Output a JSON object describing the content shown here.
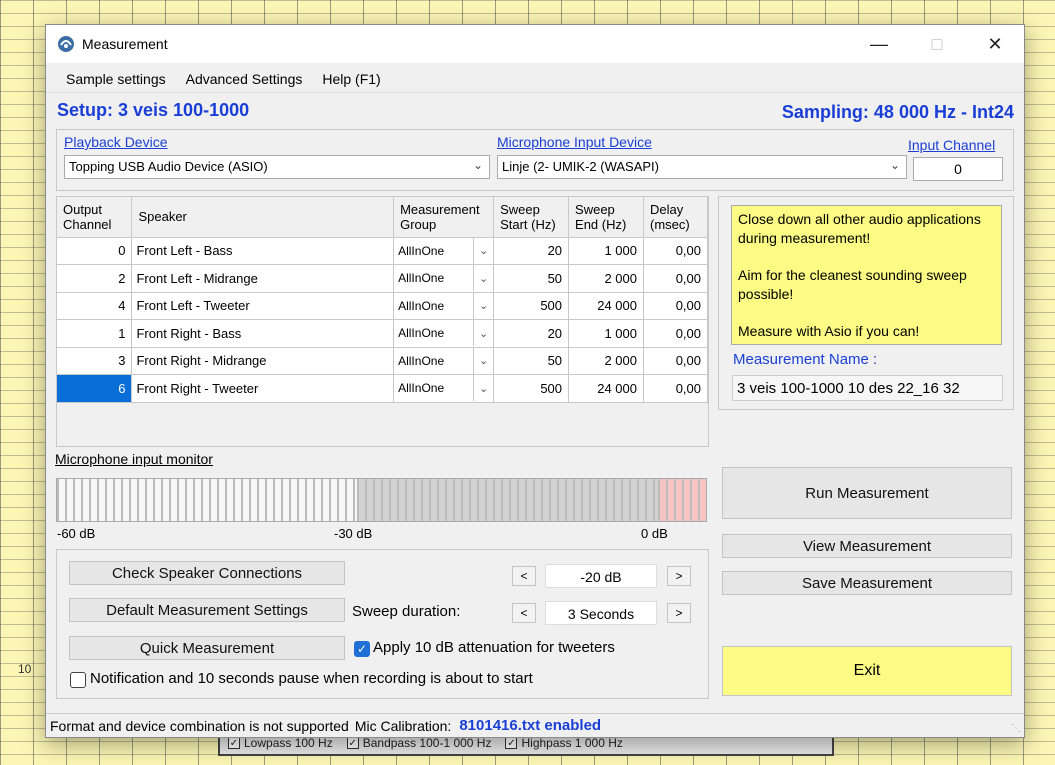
{
  "window": {
    "title": "Measurement"
  },
  "menu": [
    "Sample settings",
    "Advanced Settings",
    "Help (F1)"
  ],
  "setup_title": "Setup: 3 veis 100-1000",
  "sampling_title": "Sampling: 48 000 Hz - Int24",
  "devices": {
    "playback_label": "Playback Device",
    "playback_value": "Topping USB Audio Device (ASIO)",
    "mic_label": "Microphone Input Device",
    "mic_value": "Linje (2- UMIK-2 (WASAPI)",
    "input_channel_label": "Input Channel",
    "input_channel_value": "0"
  },
  "table": {
    "headers": [
      "Output\nChannel",
      "Speaker",
      "Measurement\nGroup",
      "Sweep\nStart (Hz)",
      "Sweep\nEnd (Hz)",
      "Delay\n(msec)"
    ],
    "rows": [
      {
        "channel": "0",
        "speaker": "Front Left - Bass",
        "group": "AllInOne",
        "start": "20",
        "end": "1 000",
        "delay": "0,00"
      },
      {
        "channel": "2",
        "speaker": "Front Left - Midrange",
        "group": "AllInOne",
        "start": "50",
        "end": "2 000",
        "delay": "0,00"
      },
      {
        "channel": "4",
        "speaker": "Front Left - Tweeter",
        "group": "AllInOne",
        "start": "500",
        "end": "24 000",
        "delay": "0,00"
      },
      {
        "channel": "1",
        "speaker": "Front Right - Bass",
        "group": "AllInOne",
        "start": "20",
        "end": "1 000",
        "delay": "0,00"
      },
      {
        "channel": "3",
        "speaker": "Front Right - Midrange",
        "group": "AllInOne",
        "start": "50",
        "end": "2 000",
        "delay": "0,00"
      },
      {
        "channel": "6",
        "speaker": "Front Right - Tweeter",
        "group": "AllInOne",
        "start": "500",
        "end": "24 000",
        "delay": "0,00"
      }
    ],
    "selected_row": 5
  },
  "info": {
    "line1": "Close down all other audio applications during measurement!",
    "line2": "Aim for the cleanest sounding sweep possible!",
    "line3": "Measure with Asio if you can!",
    "meas_name_label": "Measurement Name :",
    "meas_name_value": "3 veis 100-1000 10 des 22_16 32"
  },
  "monitor": {
    "label": "Microphone input monitor",
    "db_min": "-60 dB",
    "db_mid": "-30 dB",
    "db_max": "0 dB"
  },
  "controls": {
    "check_connections": "Check Speaker Connections",
    "default_settings": "Default Measurement Settings",
    "quick_measurement": "Quick Measurement",
    "level_value": "-20 dB",
    "sweep_duration_label": "Sweep duration:",
    "sweep_duration_value": "3 Seconds",
    "prev": "<",
    "next": ">",
    "apply_attenuation": "Apply 10 dB attenuation for tweeters",
    "apply_attenuation_checked": true,
    "notification": "Notification and 10 seconds pause when recording is about to start",
    "notification_checked": false
  },
  "actions": {
    "run": "Run Measurement",
    "view": "View Measurement",
    "save": "Save Measurement",
    "exit": "Exit"
  },
  "status": {
    "message": "Format and device combination is not supported",
    "mic_cal_label": "Mic Calibration:",
    "mic_cal_value": "8101416.txt enabled"
  },
  "background": {
    "tick_label": "10",
    "legend": [
      "Lowpass 100 Hz",
      "Bandpass 100-1 000 Hz",
      "Highpass 1 000 Hz"
    ]
  },
  "colors": {
    "accent_blue": "#1a3fd6",
    "info_yellow": "#fcfc84",
    "selection": "#0a6ed8"
  }
}
